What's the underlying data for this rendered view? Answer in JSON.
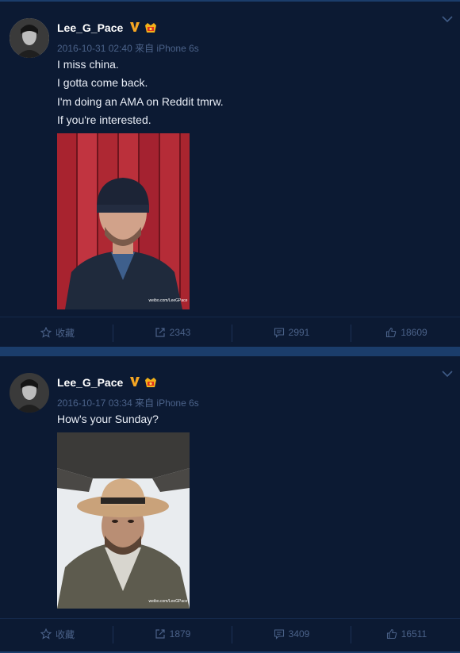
{
  "posts": [
    {
      "author": "Lee_G_Pace",
      "meta": "2016-10-31 02:40 来自 iPhone 6s",
      "lines": [
        "I miss china.",
        "I gotta come back.",
        "I'm doing an AMA on Reddit tmrw.",
        "If you're interested."
      ],
      "watermark": "weibo.com/LeeGPace",
      "actions": {
        "favorite": "收藏",
        "repost": "2343",
        "comment": "2991",
        "like": "18609"
      }
    },
    {
      "author": "Lee_G_Pace",
      "meta": "2016-10-17 03:34 来自 iPhone 6s",
      "lines": [
        "How's your Sunday?"
      ],
      "watermark": "weibo.com/LeeGPace",
      "actions": {
        "favorite": "收藏",
        "repost": "1879",
        "comment": "3409",
        "like": "16511"
      }
    }
  ],
  "colors": {
    "background": "#1b3d6b",
    "card": "#0c1a33",
    "muted_text": "#4b6289",
    "verified_badge": "#f5a623"
  },
  "icons": [
    "chevron-down-icon",
    "verified-icon",
    "member-badge-icon",
    "star-icon",
    "repost-icon",
    "comment-icon",
    "like-icon"
  ]
}
